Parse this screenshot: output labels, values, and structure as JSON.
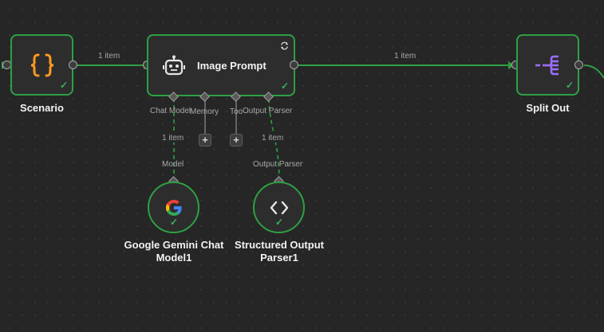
{
  "nodes": {
    "scenario": {
      "title": "Scenario",
      "icon": "code-braces-icon",
      "status": "success"
    },
    "image_prompt": {
      "title": "Image Prompt",
      "icon": "robot-icon",
      "status": "success",
      "badge_icon": "refresh-icon"
    },
    "split_out": {
      "title": "Split Out",
      "icon": "split-icon",
      "status": "success"
    },
    "gemini": {
      "title_line1": "Google Gemini Chat",
      "title_line2": "Model1",
      "icon": "google-g-icon",
      "status": "success"
    },
    "parser": {
      "title_line1": "Structured Output",
      "title_line2": "Parser1",
      "icon": "code-brackets-icon",
      "status": "success"
    }
  },
  "edges": {
    "scenario_to_prompt": "1 item",
    "prompt_to_split": "1 item",
    "model_to_prompt": "1 item",
    "parser_to_prompt": "1 item"
  },
  "ports": {
    "chat_model": "Chat Model",
    "memory": "Memory",
    "tool": "Tool",
    "output_parser": "Output Parser",
    "model_out": "Model",
    "parser_out": "Output Parser"
  },
  "colors": {
    "canvas": "#262626",
    "node_bg": "#2d2d2e",
    "success_border": "#2ea043",
    "success_check": "#36b55a",
    "braces_orange": "#ff9a1f",
    "split_purple": "#9b6dff"
  }
}
